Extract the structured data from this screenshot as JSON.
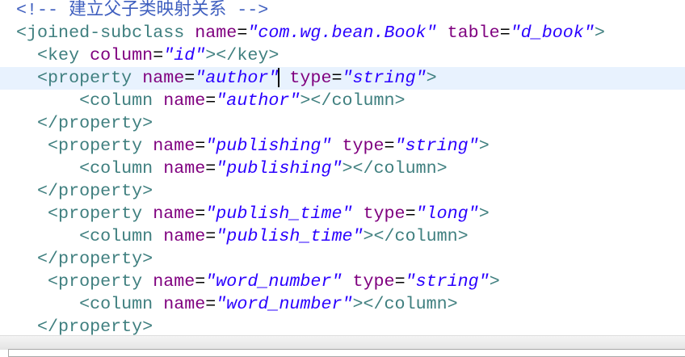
{
  "highlight_line": 3,
  "cursor": {
    "line": 3,
    "after_token": 4
  },
  "lines": [
    {
      "indent": "",
      "tokens": [
        {
          "k": "com",
          "t": "<!-- 建立父子类映射关系 -->"
        }
      ]
    },
    {
      "indent": "",
      "tokens": [
        {
          "k": "tag",
          "t": "<joined-subclass"
        },
        {
          "k": "sp",
          "t": " "
        },
        {
          "k": "attr",
          "t": "name"
        },
        {
          "k": "eq",
          "t": "="
        },
        {
          "k": "str",
          "t": "\"com.wg.bean.Book\""
        },
        {
          "k": "sp",
          "t": " "
        },
        {
          "k": "attr",
          "t": "table"
        },
        {
          "k": "eq",
          "t": "="
        },
        {
          "k": "str",
          "t": "\"d_book\""
        },
        {
          "k": "tag",
          "t": ">"
        }
      ]
    },
    {
      "indent": "  ",
      "tokens": [
        {
          "k": "tag",
          "t": "<key"
        },
        {
          "k": "sp",
          "t": " "
        },
        {
          "k": "attr",
          "t": "column"
        },
        {
          "k": "eq",
          "t": "="
        },
        {
          "k": "str",
          "t": "\"id\""
        },
        {
          "k": "tag",
          "t": "></key>"
        }
      ]
    },
    {
      "indent": "  ",
      "tokens": [
        {
          "k": "tag",
          "t": "<property"
        },
        {
          "k": "sp",
          "t": " "
        },
        {
          "k": "attr",
          "t": "name"
        },
        {
          "k": "eq",
          "t": "="
        },
        {
          "k": "str",
          "t": "\"author\""
        },
        {
          "k": "sp",
          "t": " "
        },
        {
          "k": "attr",
          "t": "type"
        },
        {
          "k": "eq",
          "t": "="
        },
        {
          "k": "str",
          "t": "\"string\""
        },
        {
          "k": "tag",
          "t": ">"
        }
      ]
    },
    {
      "indent": "      ",
      "tokens": [
        {
          "k": "tag",
          "t": "<column"
        },
        {
          "k": "sp",
          "t": " "
        },
        {
          "k": "attr",
          "t": "name"
        },
        {
          "k": "eq",
          "t": "="
        },
        {
          "k": "str",
          "t": "\"author\""
        },
        {
          "k": "tag",
          "t": "></column>"
        }
      ]
    },
    {
      "indent": "  ",
      "tokens": [
        {
          "k": "tag",
          "t": "</property>"
        }
      ]
    },
    {
      "indent": "   ",
      "tokens": [
        {
          "k": "tag",
          "t": "<property"
        },
        {
          "k": "sp",
          "t": " "
        },
        {
          "k": "attr",
          "t": "name"
        },
        {
          "k": "eq",
          "t": "="
        },
        {
          "k": "str",
          "t": "\"publishing\""
        },
        {
          "k": "sp",
          "t": " "
        },
        {
          "k": "attr",
          "t": "type"
        },
        {
          "k": "eq",
          "t": "="
        },
        {
          "k": "str",
          "t": "\"string\""
        },
        {
          "k": "tag",
          "t": ">"
        }
      ]
    },
    {
      "indent": "      ",
      "tokens": [
        {
          "k": "tag",
          "t": "<column"
        },
        {
          "k": "sp",
          "t": " "
        },
        {
          "k": "attr",
          "t": "name"
        },
        {
          "k": "eq",
          "t": "="
        },
        {
          "k": "str",
          "t": "\"publishing\""
        },
        {
          "k": "tag",
          "t": "></column>"
        }
      ]
    },
    {
      "indent": "  ",
      "tokens": [
        {
          "k": "tag",
          "t": "</property>"
        }
      ]
    },
    {
      "indent": "   ",
      "tokens": [
        {
          "k": "tag",
          "t": "<property"
        },
        {
          "k": "sp",
          "t": " "
        },
        {
          "k": "attr",
          "t": "name"
        },
        {
          "k": "eq",
          "t": "="
        },
        {
          "k": "str",
          "t": "\"publish_time\""
        },
        {
          "k": "sp",
          "t": " "
        },
        {
          "k": "attr",
          "t": "type"
        },
        {
          "k": "eq",
          "t": "="
        },
        {
          "k": "str",
          "t": "\"long\""
        },
        {
          "k": "tag",
          "t": ">"
        }
      ]
    },
    {
      "indent": "      ",
      "tokens": [
        {
          "k": "tag",
          "t": "<column"
        },
        {
          "k": "sp",
          "t": " "
        },
        {
          "k": "attr",
          "t": "name"
        },
        {
          "k": "eq",
          "t": "="
        },
        {
          "k": "str",
          "t": "\"publish_time\""
        },
        {
          "k": "tag",
          "t": "></column>"
        }
      ]
    },
    {
      "indent": "  ",
      "tokens": [
        {
          "k": "tag",
          "t": "</property>"
        }
      ]
    },
    {
      "indent": "   ",
      "tokens": [
        {
          "k": "tag",
          "t": "<property"
        },
        {
          "k": "sp",
          "t": " "
        },
        {
          "k": "attr",
          "t": "name"
        },
        {
          "k": "eq",
          "t": "="
        },
        {
          "k": "str",
          "t": "\"word_number\""
        },
        {
          "k": "sp",
          "t": " "
        },
        {
          "k": "attr",
          "t": "type"
        },
        {
          "k": "eq",
          "t": "="
        },
        {
          "k": "str",
          "t": "\"string\""
        },
        {
          "k": "tag",
          "t": ">"
        }
      ]
    },
    {
      "indent": "      ",
      "tokens": [
        {
          "k": "tag",
          "t": "<column"
        },
        {
          "k": "sp",
          "t": " "
        },
        {
          "k": "attr",
          "t": "name"
        },
        {
          "k": "eq",
          "t": "="
        },
        {
          "k": "str",
          "t": "\"word_number\""
        },
        {
          "k": "tag",
          "t": "></column>"
        }
      ]
    },
    {
      "indent": "  ",
      "tokens": [
        {
          "k": "tag",
          "t": "</property>"
        }
      ]
    }
  ]
}
